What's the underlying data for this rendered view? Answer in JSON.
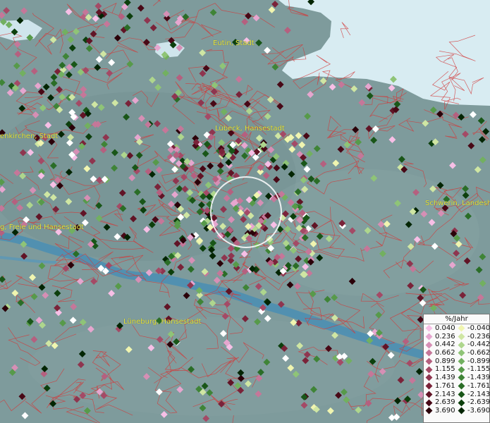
{
  "cities": [
    {
      "id": "eutin",
      "label": "Eutin, Stadt"
    },
    {
      "id": "luebeck",
      "label": "Lübeck, Hansestadt"
    },
    {
      "id": "neukirchen",
      "label": "enkirchen, Stadt"
    },
    {
      "id": "hamburg",
      "label": "g, Freie und Hansestadt"
    },
    {
      "id": "schwerin",
      "label": "Schwerin, Landesh"
    },
    {
      "id": "lueneburg",
      "label": "Lüneburg, Hansestadt"
    }
  ],
  "legend": {
    "title": "%/Jahr",
    "positive": [
      {
        "label": "0.040",
        "color": "#f7bfe6"
      },
      {
        "label": "0.236",
        "color": "#e6a6cf"
      },
      {
        "label": "0.442",
        "color": "#d68fb5"
      },
      {
        "label": "0.662",
        "color": "#c57799"
      },
      {
        "label": "0.899",
        "color": "#b5607f"
      },
      {
        "label": "1.155",
        "color": "#a44a66"
      },
      {
        "label": "1.439",
        "color": "#8f354f"
      },
      {
        "label": "1.761",
        "color": "#7a2339"
      },
      {
        "label": "2.143",
        "color": "#611426"
      },
      {
        "label": "2.639",
        "color": "#480816"
      },
      {
        "label": "3.690",
        "color": "#2a0009"
      }
    ],
    "negative": [
      {
        "label": "-0.040",
        "color": "#f0f5b0"
      },
      {
        "label": "-0.236",
        "color": "#cfe6a3"
      },
      {
        "label": "-0.442",
        "color": "#aed68d"
      },
      {
        "label": "-0.662",
        "color": "#8fc477"
      },
      {
        "label": "-0.899",
        "color": "#72b060"
      },
      {
        "label": "-1.155",
        "color": "#579a4a"
      },
      {
        "label": "-1.439",
        "color": "#3f8437"
      },
      {
        "label": "-1.761",
        "color": "#2a6d27"
      },
      {
        "label": "-2.143",
        "color": "#195618"
      },
      {
        "label": "-2.639",
        "color": "#0c3f0c"
      },
      {
        "label": "-3.690",
        "color": "#032503"
      }
    ]
  },
  "colors": {
    "land": "#7e9b9c",
    "sea": "#d8ecf2",
    "river": "#4d8fb2",
    "border": "#d23a3a",
    "label": "#e8e23a"
  }
}
